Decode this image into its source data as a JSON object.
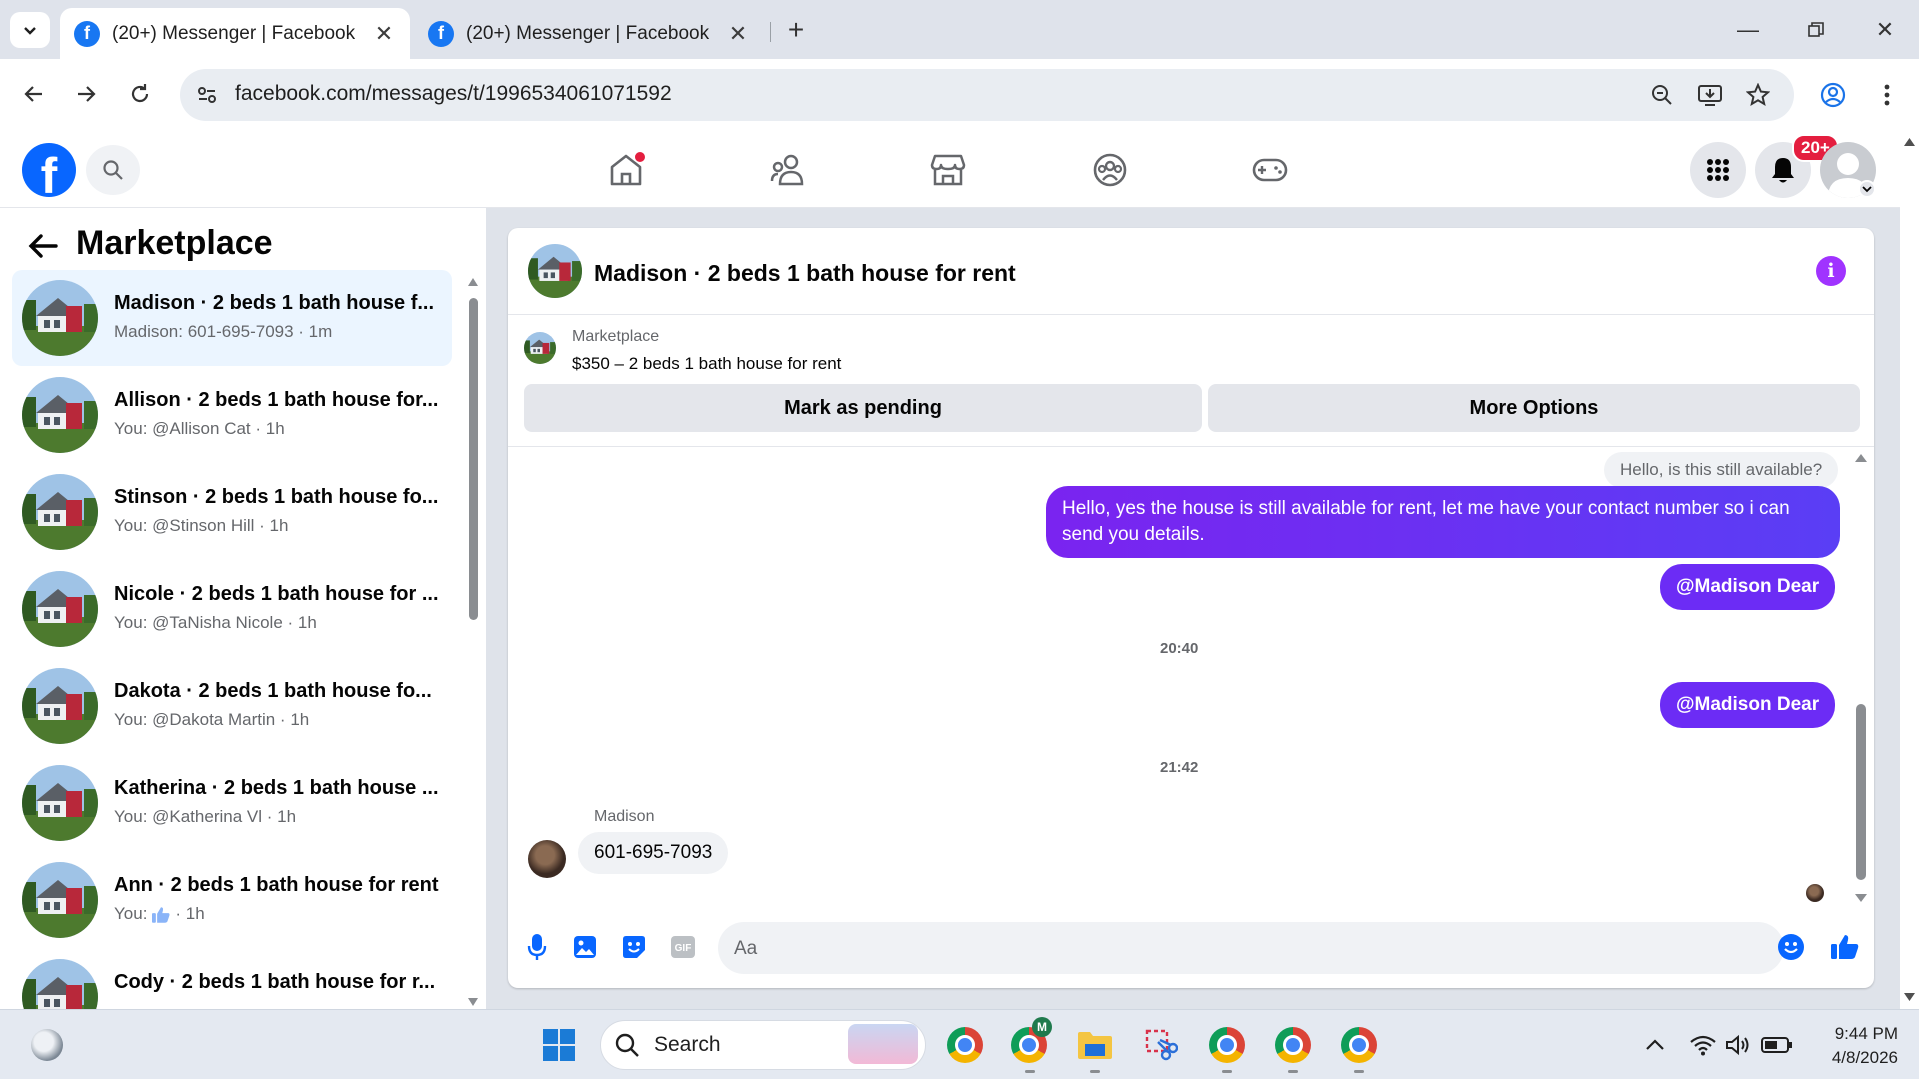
{
  "browser": {
    "tabs": [
      {
        "title": "(20+) Messenger | Facebook",
        "active": true
      },
      {
        "title": "(20+) Messenger | Facebook",
        "active": false
      }
    ],
    "url": "facebook.com/messages/t/1996534061071592"
  },
  "fb_header": {
    "notification_badge": "20+"
  },
  "sidebar": {
    "title": "Marketplace",
    "conversations": [
      {
        "name": "Madison · 2 beds 1 bath house f...",
        "preview": "Madison: 601-695-7093 · 1m",
        "selected": true
      },
      {
        "name": "Allison · 2 beds 1 bath house for...",
        "preview": "You: @Allison Cat · 1h"
      },
      {
        "name": "Stinson · 2 beds 1 bath house fo...",
        "preview": "You: @Stinson Hill · 1h"
      },
      {
        "name": "Nicole · 2 beds 1 bath house for ...",
        "preview": "You: @TaNisha Nicole · 1h"
      },
      {
        "name": "Dakota · 2 beds 1 bath house fo...",
        "preview": "You: @Dakota Martin · 1h"
      },
      {
        "name": "Katherina · 2 beds 1 bath house ...",
        "preview": "You: @Katherina Vl · 1h"
      },
      {
        "name": "Ann · 2 beds 1 bath house for rent",
        "preview_prefix": "You:",
        "preview_suffix": "· 1h"
      },
      {
        "name": "Cody · 2 beds 1 bath house for r...",
        "preview": ""
      }
    ]
  },
  "chat": {
    "title": "Madison · 2 beds 1 bath house for rent",
    "marketplace_label": "Marketplace",
    "listing": "$350 – 2 beds 1 bath house for rent",
    "mark_pending": "Mark as pending",
    "more_options": "More Options",
    "messages": {
      "incoming_top": "Hello, is this still available?",
      "outgoing_long": "Hello, yes the house is still available for rent, let me have your contact number so i can send you details.",
      "mention_1": "@Madison Dear",
      "time_1": "20:40",
      "mention_2": "@Madison Dear",
      "time_2": "21:42",
      "sender": "Madison",
      "incoming_phone": "601-695-7093"
    },
    "composer_placeholder": "Aa"
  },
  "taskbar": {
    "search": "Search",
    "time": "9:44 PM",
    "date": "4/8/2026"
  }
}
